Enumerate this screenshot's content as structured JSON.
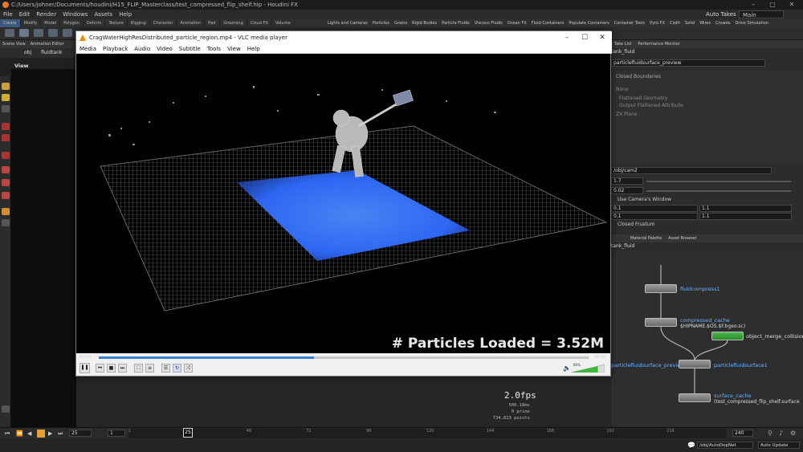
{
  "houdini": {
    "title": "C:/Users/johner/Documents/houdini/H15_FLIP_Masterclass/test_compressed_flip_shelf.hip - Houdini FX",
    "menu": [
      "File",
      "Edit",
      "Render",
      "Windows",
      "Assets",
      "Help"
    ],
    "auto_takes": "Auto Takes",
    "desktop": "Main",
    "shelf_tabs_left": [
      "Create",
      "Modify",
      "Model",
      "Polygon",
      "Deform",
      "Texture",
      "Rigging",
      "Character",
      "Animation",
      "Hair",
      "Grooming",
      "Cloud FX",
      "Volume"
    ],
    "shelf_tabs_right": [
      "Lights and Cameras",
      "Particles",
      "Grains",
      "Rigid Bodies",
      "Particle Fluids",
      "Viscous Fluids",
      "Ocean FX",
      "Fluid Containers",
      "Populate Containers",
      "Container Tools",
      "Pyro FX",
      "Cloth",
      "Solid",
      "Wires",
      "Crowds",
      "Drive Simulation"
    ],
    "left_tabs": [
      "Scene View",
      "Animation Editor"
    ],
    "left_path": "obj",
    "left_node": "fluidtank",
    "view_label": "View",
    "right_tabs": [
      "Take List",
      "Performance Monitor"
    ],
    "right_path": "tank_fluid",
    "param_node": "particlefluidsurface_preview",
    "closed_boundaries": "Closed Boundaries",
    "none_label": "None",
    "flattened_geometry": "Flattened Geometry",
    "output_flattened": "Output Flattened Attribute",
    "zx_plane": "ZX Plane",
    "camera_path": "/obj/cam2",
    "field_a": "1.7",
    "field_b": "0.02",
    "use_camera_window": "Use Camera's Window",
    "v1": "0.1",
    "v2": "1.1",
    "v3": "0.1",
    "v4": "1.1",
    "closed_frustum": "Closed Frustum",
    "net_tabs": [
      "Material Palette",
      "Asset Browser"
    ],
    "net_path": "tank_fluid",
    "nodes": {
      "n1": "fluidcompress1",
      "n2": "compressed_cache",
      "n2_sub": "$HIPNAME.$OS.$F.bgeo.sc)",
      "n3": "object_merge_collision",
      "n4": "particlefluidsurface_preview",
      "n5": "particlefluidsurface1",
      "n6": "surface_cache",
      "n6_sub": "(test_compressed_flip_shelf.surface"
    },
    "fps": "2.0fps",
    "stats": [
      "506.18ms",
      "0  prims",
      "734,823 points"
    ],
    "frame_current": "25",
    "frame_start": "1",
    "frame_end": "240",
    "ticks": [
      "1",
      "48",
      "72",
      "96",
      "120",
      "144",
      "168",
      "192",
      "216"
    ],
    "playhead": "25",
    "status_path": "/obj/AutoDopNet",
    "auto_update": "Auto Update"
  },
  "vlc": {
    "title": "CragWaterHighResDistributed_particle_region.mp4 - VLC media player",
    "menu": [
      "Media",
      "Playback",
      "Audio",
      "Video",
      "Subtitle",
      "Tools",
      "View",
      "Help"
    ],
    "overlay_text": "# Particles Loaded = 3.52M",
    "time_current": "00:09",
    "time_total": "00:20",
    "progress": 0.44,
    "volume_percent": "80%",
    "volume": 0.8
  },
  "colors": {
    "water": "#2f6bff",
    "vlc_accent": "#3b7fd1",
    "houdini_orange": "#e87722",
    "node_label": "#6fb3ff"
  }
}
